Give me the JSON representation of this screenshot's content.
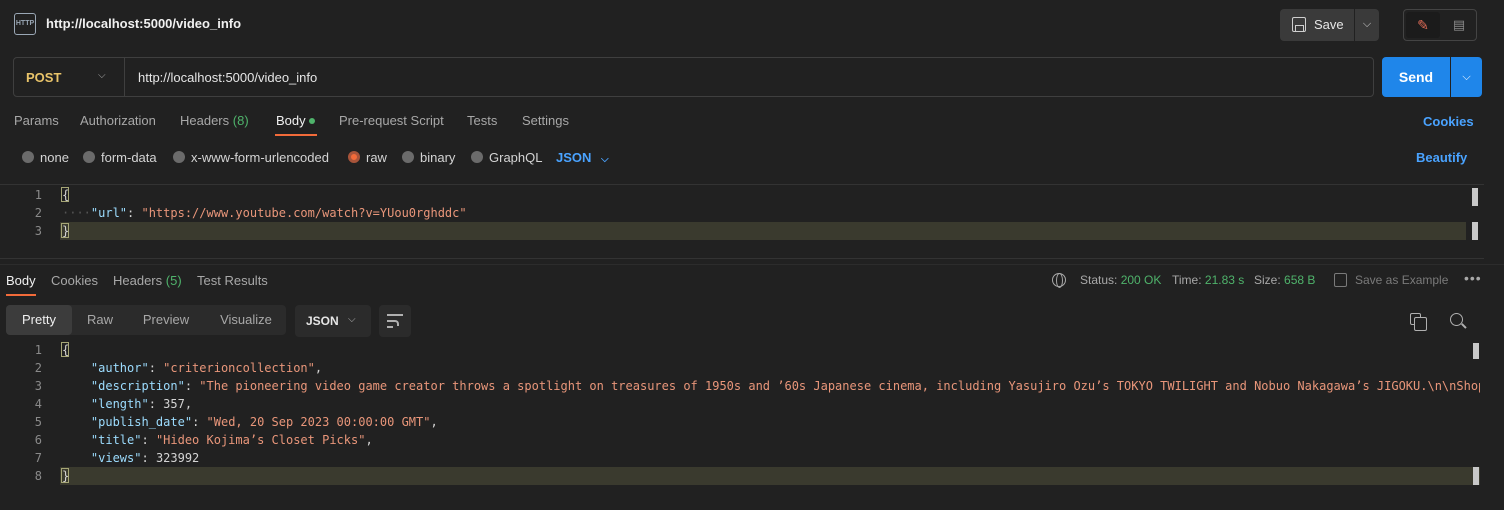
{
  "request": {
    "tab_title": "http://localhost:5000/video_info",
    "http_icon": "HTTP",
    "save_label": "Save",
    "method": "POST",
    "url": "http://localhost:5000/video_info",
    "send_label": "Send"
  },
  "request_tabs": {
    "params": "Params",
    "authorization": "Authorization",
    "headers": "Headers",
    "headers_count": "(8)",
    "body": "Body",
    "pre_request": "Pre-request Script",
    "tests": "Tests",
    "settings": "Settings",
    "cookies": "Cookies"
  },
  "body_types": {
    "none": "none",
    "form_data": "form-data",
    "urlencoded": "x-www-form-urlencoded",
    "raw": "raw",
    "binary": "binary",
    "graphql": "GraphQL",
    "format": "JSON",
    "beautify": "Beautify",
    "selected": "raw"
  },
  "request_body": {
    "line_numbers": [
      "1",
      "2",
      "3"
    ],
    "open_brace": "{",
    "key": "\"url\"",
    "value": "\"https://www.youtube.com/watch?v=YUou0rghddc\"",
    "close_brace": "}"
  },
  "response_tabs": {
    "body": "Body",
    "cookies": "Cookies",
    "headers": "Headers",
    "headers_count": "(5)",
    "test_results": "Test Results"
  },
  "response_status": {
    "status_label": "Status:",
    "status_value": "200 OK",
    "time_label": "Time:",
    "time_value": "21.83 s",
    "size_label": "Size:",
    "size_value": "658 B",
    "save_example": "Save as Example",
    "more": "ooo"
  },
  "response_format": {
    "pretty": "Pretty",
    "raw": "Raw",
    "preview": "Preview",
    "visualize": "Visualize",
    "language": "JSON"
  },
  "response_body": {
    "line_numbers": [
      "1",
      "2",
      "3",
      "4",
      "5",
      "6",
      "7",
      "8"
    ],
    "open_brace": "{",
    "author_key": "\"author\"",
    "author_value": "\"criterioncollection\"",
    "description_key": "\"description\"",
    "description_value": "\"The pioneering video game creator throws a spotlight on treasures of 1950s and ’60s Japanese cinema, including Yasujiro Ozu’s TOKYO TWILIGHT and Nobuo Nakagawa’s JIGOKU.\\n\\nShop",
    "length_key": "\"length\"",
    "length_value": "357",
    "publish_key": "\"publish_date\"",
    "publish_value": "\"Wed, 20 Sep 2023 00:00:00 GMT\"",
    "title_key": "\"title\"",
    "title_value": "\"Hideo Kojima’s Closet Picks\"",
    "views_key": "\"views\"",
    "views_value": "323992",
    "close_brace": "}"
  },
  "colors": {
    "accent": "#f26b3a",
    "send_blue": "#1f86ea",
    "success_green": "#4fb36b",
    "method_yellow": "#e9c46a"
  }
}
